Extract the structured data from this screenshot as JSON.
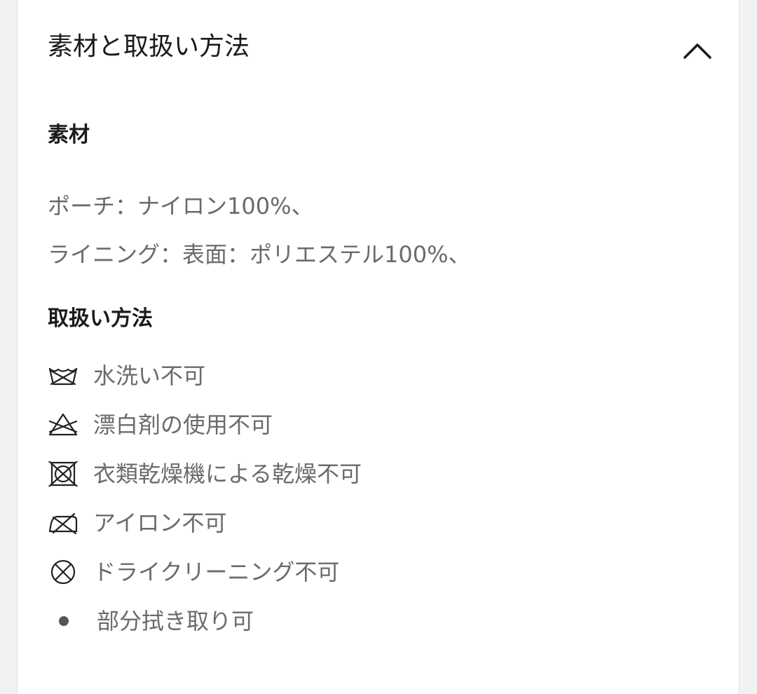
{
  "section": {
    "title": "素材と取扱い方法",
    "expanded": true
  },
  "materials": {
    "heading": "素材",
    "lines": [
      "ポーチ：ナイロン100%、",
      "ライニング：表面：ポリエステル100%、"
    ]
  },
  "care": {
    "heading": "取扱い方法",
    "items": [
      {
        "icon": "no-wash-icon",
        "label": "水洗い不可"
      },
      {
        "icon": "no-bleach-icon",
        "label": "漂白剤の使用不可"
      },
      {
        "icon": "no-tumble-dry-icon",
        "label": "衣類乾燥機による乾燥不可"
      },
      {
        "icon": "no-iron-icon",
        "label": "アイロン不可"
      },
      {
        "icon": "no-dry-clean-icon",
        "label": "ドライクリーニング不可"
      },
      {
        "icon": "bullet-icon",
        "label": "部分拭き取り可"
      }
    ]
  },
  "colors": {
    "heading_text": "#1a1a1a",
    "body_text": "#6b6b6b",
    "icon_stroke": "#222222"
  }
}
